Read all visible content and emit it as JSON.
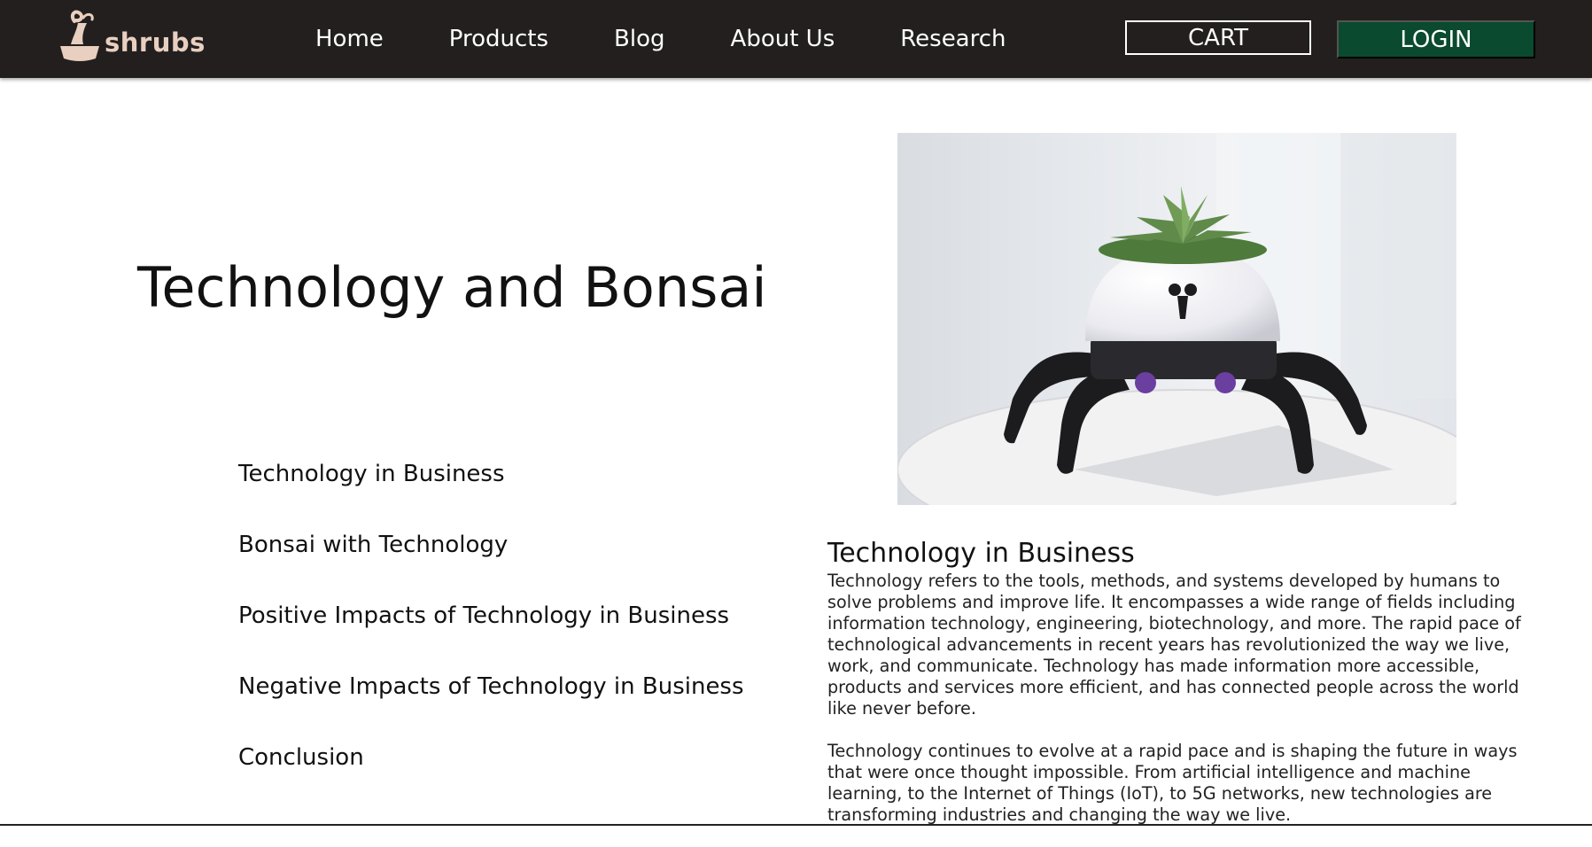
{
  "brand": {
    "name": "shrubs",
    "logo_icon": "bonsai-pot-icon"
  },
  "nav": {
    "links": [
      "Home",
      "Products",
      "Blog",
      "About Us",
      "Research"
    ],
    "cart_label": "CART",
    "login_label": "LOGIN"
  },
  "hero": {
    "title": "Technology and Bonsai",
    "image_icon": "robot-plant-image"
  },
  "toc": {
    "items": [
      "Technology in Business",
      "Bonsai with Technology",
      "Positive Impacts of Technology in Business",
      "Negative Impacts of Technology in Business",
      "Conclusion"
    ]
  },
  "article": {
    "heading": "Technology in Business",
    "paragraphs": [
      "Technology refers to the tools, methods, and systems developed by humans to solve problems and improve life. It encompasses a wide range of fields including information technology, engineering, biotechnology, and more. The rapid pace of technological advancements in recent years has revolutionized the way we live, work, and communicate. Technology has made information more accessible, products and services more efficient, and has connected people across the world like never before.",
      "Technology continues to evolve at a rapid pace and is shaping the future in ways that were once thought impossible. From artificial intelligence and machine learning, to the Internet of Things (IoT), to 5G networks, new technologies are transforming industries and changing the way we live."
    ]
  },
  "colors": {
    "navbar_bg": "#231f1f",
    "logo_accent": "#e8cfc0",
    "login_bg": "#0a4a2e",
    "text": "#111111"
  }
}
